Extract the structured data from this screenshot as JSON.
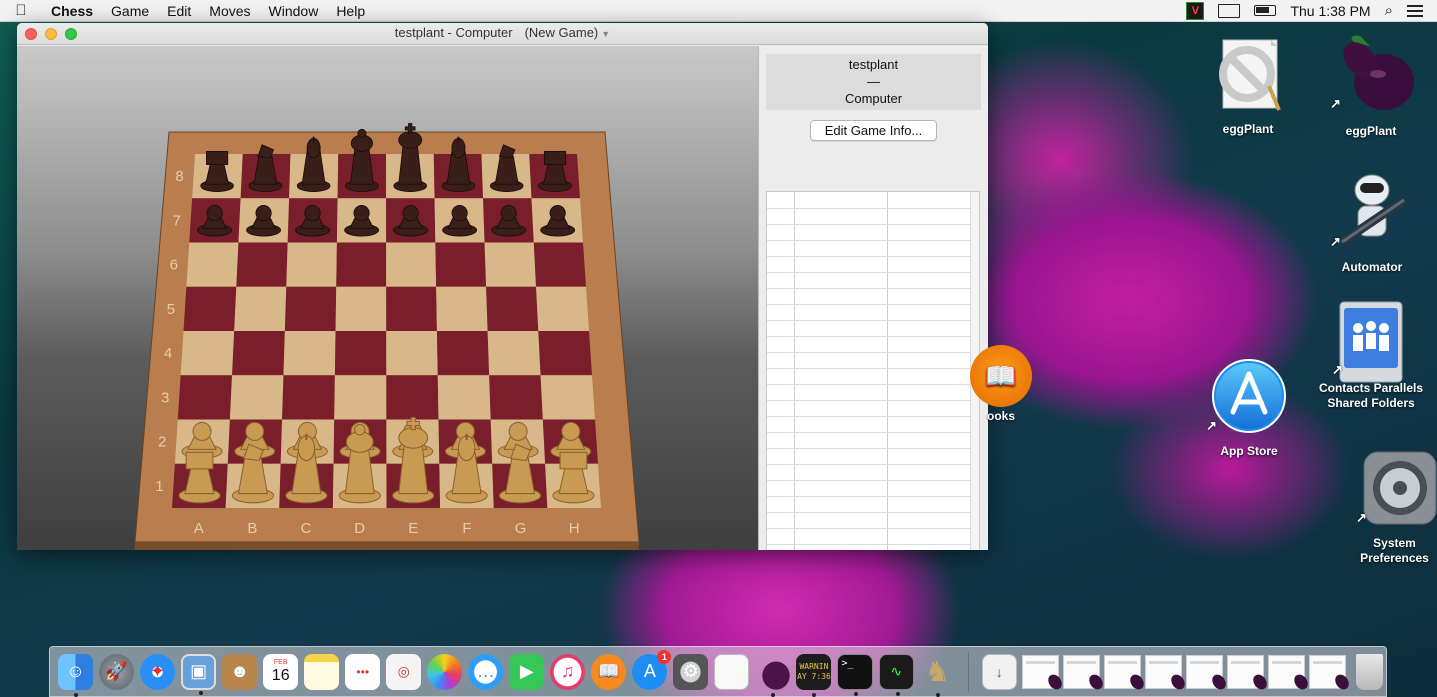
{
  "menubar": {
    "app_name": "Chess",
    "items": [
      "Game",
      "Edit",
      "Moves",
      "Window",
      "Help"
    ],
    "clock": "Thu 1:38 PM"
  },
  "window": {
    "title": "testplant - Computer",
    "subtitle": "(New Game)"
  },
  "board": {
    "ranks": [
      "8",
      "7",
      "6",
      "5",
      "4",
      "3",
      "2",
      "1"
    ],
    "files": [
      "A",
      "B",
      "C",
      "D",
      "E",
      "F",
      "G",
      "H"
    ],
    "light_square_color": "#d8b888",
    "dark_square_color": "#7a1e2c",
    "frame_color": "#b97d4e"
  },
  "sidebar": {
    "white_player": "testplant",
    "separator": "—",
    "black_player": "Computer",
    "edit_button": "Edit Game Info..."
  },
  "desktop_icons": [
    {
      "name": "eggplant-app",
      "label": "eggPlant"
    },
    {
      "name": "eggplant-alias",
      "label": "eggPlant"
    },
    {
      "name": "automator",
      "label": "Automator"
    },
    {
      "name": "parallels-folders",
      "label": "Contacts Parallels Shared Folders"
    },
    {
      "name": "app-store",
      "label": "App Store"
    },
    {
      "name": "books",
      "label": "ooks"
    },
    {
      "name": "system-preferences",
      "label": "System Preferences"
    }
  ],
  "dock": {
    "calendar_month": "FEB",
    "calendar_day": "16",
    "appstore_badge": "1",
    "console_text": "WARNIN",
    "console_time": "AY 7:36",
    "terminal_prompt": ">_"
  }
}
